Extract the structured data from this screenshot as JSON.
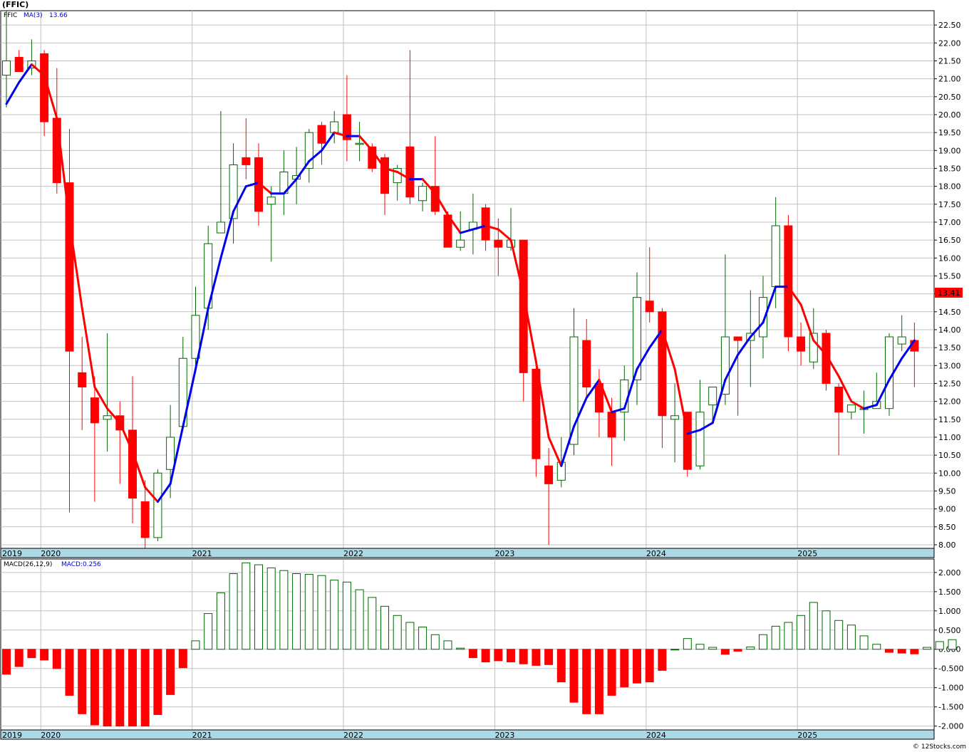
{
  "header": {
    "symbol": "(FFIC)",
    "legend_symbol": "FFIC",
    "legend_ma": "MA(3)",
    "legend_ma_value": "13.66",
    "last_price": "13.41"
  },
  "macd_panel": {
    "label": "MACD(26,12,9)",
    "value_label": "MACD:0.256"
  },
  "watermark": "© 12Stocks.com",
  "colors": {
    "up": "#006600",
    "down": "#ff0000",
    "ma_up": "#0000ee",
    "ma_down": "#ff0000",
    "grid": "#c0c0c0",
    "date_band": "#add8e6",
    "price_tag": "#ff0000"
  },
  "chart_data": [
    {
      "type": "candlestick",
      "title": "(FFIC)",
      "ylim": [
        7.9,
        22.9
      ],
      "yticks": [
        "8.00",
        "8.50",
        "9.00",
        "9.50",
        "10.00",
        "10.50",
        "11.00",
        "11.50",
        "12.00",
        "12.50",
        "13.00",
        "13.50",
        "14.00",
        "14.50",
        "15.00",
        "15.50",
        "16.00",
        "16.50",
        "17.00",
        "17.50",
        "18.00",
        "18.50",
        "19.00",
        "19.50",
        "20.00",
        "20.50",
        "21.00",
        "21.50",
        "22.00",
        "22.50"
      ],
      "year_labels": [
        "2019",
        "2020",
        "2021",
        "2022",
        "2023",
        "2024",
        "2025"
      ],
      "year_start_month_index": [
        0,
        3,
        15,
        27,
        39,
        51,
        63
      ],
      "candles": [
        {
          "o": 21.1,
          "h": 22.9,
          "l": 20.2,
          "c": 21.5
        },
        {
          "o": 21.6,
          "h": 21.8,
          "l": 21.2,
          "c": 21.2
        },
        {
          "o": 21.3,
          "h": 22.1,
          "l": 21.1,
          "c": 21.5
        },
        {
          "o": 21.7,
          "h": 21.8,
          "l": 19.4,
          "c": 19.8
        },
        {
          "o": 19.9,
          "h": 21.3,
          "l": 17.8,
          "c": 18.1
        },
        {
          "o": 18.1,
          "h": 19.6,
          "l": 8.9,
          "c": 13.4
        },
        {
          "o": 12.8,
          "h": 13.8,
          "l": 11.2,
          "c": 12.4
        },
        {
          "o": 12.1,
          "h": 12.7,
          "l": 9.2,
          "c": 11.4
        },
        {
          "o": 11.5,
          "h": 13.9,
          "l": 10.6,
          "c": 11.6
        },
        {
          "o": 11.6,
          "h": 12.0,
          "l": 9.7,
          "c": 11.2
        },
        {
          "o": 11.2,
          "h": 12.7,
          "l": 8.6,
          "c": 9.3
        },
        {
          "o": 9.2,
          "h": 9.8,
          "l": 7.9,
          "c": 8.2
        },
        {
          "o": 8.2,
          "h": 10.1,
          "l": 8.1,
          "c": 10.0
        },
        {
          "o": 10.1,
          "h": 11.9,
          "l": 9.3,
          "c": 11.0
        },
        {
          "o": 11.3,
          "h": 13.8,
          "l": 11.2,
          "c": 13.2
        },
        {
          "o": 13.2,
          "h": 15.2,
          "l": 12.9,
          "c": 14.4
        },
        {
          "o": 14.6,
          "h": 16.9,
          "l": 14.0,
          "c": 16.4
        },
        {
          "o": 16.7,
          "h": 20.1,
          "l": 16.7,
          "c": 17.0
        },
        {
          "o": 17.1,
          "h": 19.2,
          "l": 16.4,
          "c": 18.6
        },
        {
          "o": 18.8,
          "h": 19.9,
          "l": 18.2,
          "c": 18.6
        },
        {
          "o": 18.8,
          "h": 19.2,
          "l": 16.9,
          "c": 17.3
        },
        {
          "o": 17.5,
          "h": 18.0,
          "l": 15.9,
          "c": 17.7
        },
        {
          "o": 17.8,
          "h": 19.0,
          "l": 17.2,
          "c": 18.4
        },
        {
          "o": 18.2,
          "h": 19.1,
          "l": 17.5,
          "c": 18.3
        },
        {
          "o": 18.5,
          "h": 19.6,
          "l": 18.1,
          "c": 19.5
        },
        {
          "o": 19.7,
          "h": 19.8,
          "l": 18.6,
          "c": 19.2
        },
        {
          "o": 19.5,
          "h": 20.1,
          "l": 19.2,
          "c": 19.8
        },
        {
          "o": 20.0,
          "h": 21.1,
          "l": 18.7,
          "c": 19.3
        },
        {
          "o": 19.2,
          "h": 19.8,
          "l": 18.7,
          "c": 19.2
        },
        {
          "o": 19.1,
          "h": 19.2,
          "l": 18.4,
          "c": 18.5
        },
        {
          "o": 18.8,
          "h": 18.9,
          "l": 17.2,
          "c": 17.8
        },
        {
          "o": 18.1,
          "h": 18.6,
          "l": 17.6,
          "c": 18.5
        },
        {
          "o": 19.1,
          "h": 21.8,
          "l": 17.5,
          "c": 17.7
        },
        {
          "o": 17.6,
          "h": 18.1,
          "l": 17.3,
          "c": 18.0
        },
        {
          "o": 18.0,
          "h": 19.4,
          "l": 17.2,
          "c": 17.3
        },
        {
          "o": 17.2,
          "h": 17.3,
          "l": 16.3,
          "c": 16.3
        },
        {
          "o": 16.3,
          "h": 17.3,
          "l": 16.2,
          "c": 16.5
        },
        {
          "o": 16.8,
          "h": 17.8,
          "l": 16.1,
          "c": 17.0
        },
        {
          "o": 17.4,
          "h": 17.5,
          "l": 16.2,
          "c": 16.5
        },
        {
          "o": 16.5,
          "h": 17.1,
          "l": 15.5,
          "c": 16.3
        },
        {
          "o": 16.3,
          "h": 17.4,
          "l": 16.2,
          "c": 16.5
        },
        {
          "o": 16.5,
          "h": 16.5,
          "l": 12.0,
          "c": 12.8
        },
        {
          "o": 12.9,
          "h": 13.1,
          "l": 9.9,
          "c": 10.4
        },
        {
          "o": 10.2,
          "h": 10.7,
          "l": 8.0,
          "c": 9.7
        },
        {
          "o": 9.8,
          "h": 11.0,
          "l": 9.6,
          "c": 10.3
        },
        {
          "o": 10.8,
          "h": 14.6,
          "l": 10.5,
          "c": 13.8
        },
        {
          "o": 13.7,
          "h": 14.3,
          "l": 12.1,
          "c": 12.4
        },
        {
          "o": 12.5,
          "h": 12.9,
          "l": 11.0,
          "c": 11.7
        },
        {
          "o": 11.7,
          "h": 12.1,
          "l": 10.2,
          "c": 11.0
        },
        {
          "o": 11.7,
          "h": 13.0,
          "l": 10.9,
          "c": 12.6
        },
        {
          "o": 12.6,
          "h": 15.6,
          "l": 11.9,
          "c": 14.9
        },
        {
          "o": 14.8,
          "h": 16.3,
          "l": 14.2,
          "c": 14.5
        },
        {
          "o": 14.5,
          "h": 14.6,
          "l": 10.7,
          "c": 11.6
        },
        {
          "o": 11.5,
          "h": 12.5,
          "l": 10.3,
          "c": 11.6
        },
        {
          "o": 11.7,
          "h": 11.7,
          "l": 9.9,
          "c": 10.1
        },
        {
          "o": 10.2,
          "h": 12.6,
          "l": 10.1,
          "c": 11.7
        },
        {
          "o": 11.9,
          "h": 12.4,
          "l": 11.4,
          "c": 12.4
        },
        {
          "o": 12.2,
          "h": 16.1,
          "l": 11.9,
          "c": 13.8
        },
        {
          "o": 13.8,
          "h": 13.8,
          "l": 11.6,
          "c": 13.7
        },
        {
          "o": 13.7,
          "h": 15.1,
          "l": 12.4,
          "c": 13.9
        },
        {
          "o": 13.8,
          "h": 15.5,
          "l": 13.2,
          "c": 14.9
        },
        {
          "o": 15.2,
          "h": 17.7,
          "l": 14.6,
          "c": 16.9
        },
        {
          "o": 16.9,
          "h": 17.2,
          "l": 13.4,
          "c": 13.8
        },
        {
          "o": 13.8,
          "h": 14.2,
          "l": 13.0,
          "c": 13.4
        },
        {
          "o": 13.1,
          "h": 14.6,
          "l": 12.9,
          "c": 13.9
        },
        {
          "o": 13.9,
          "h": 14.0,
          "l": 12.3,
          "c": 12.5
        },
        {
          "o": 12.4,
          "h": 12.5,
          "l": 10.5,
          "c": 11.7
        },
        {
          "o": 11.7,
          "h": 11.9,
          "l": 11.5,
          "c": 11.9
        },
        {
          "o": 11.8,
          "h": 12.3,
          "l": 11.1,
          "c": 11.8
        },
        {
          "o": 11.8,
          "h": 12.8,
          "l": 11.8,
          "c": 12.0
        },
        {
          "o": 11.8,
          "h": 13.9,
          "l": 11.6,
          "c": 13.8
        },
        {
          "o": 13.6,
          "h": 14.4,
          "l": 13.4,
          "c": 13.8
        },
        {
          "o": 13.7,
          "h": 14.2,
          "l": 12.4,
          "c": 13.4
        }
      ],
      "ma3": [
        20.3,
        20.9,
        21.4,
        21.1,
        19.9,
        17.0,
        14.6,
        12.4,
        11.8,
        11.4,
        10.6,
        9.6,
        9.2,
        9.7,
        11.3,
        12.9,
        14.6,
        16.0,
        17.3,
        18.0,
        18.1,
        17.8,
        17.8,
        18.2,
        18.7,
        19.0,
        19.5,
        19.4,
        19.4,
        19.0,
        18.5,
        18.4,
        18.2,
        18.2,
        17.8,
        17.2,
        16.7,
        16.8,
        16.9,
        16.8,
        16.5,
        15.0,
        13.1,
        11.0,
        10.2,
        11.3,
        12.1,
        12.6,
        11.7,
        11.8,
        12.9,
        13.5,
        14.0,
        12.9,
        11.1,
        11.2,
        11.4,
        12.6,
        13.3,
        13.8,
        14.2,
        15.2,
        15.2,
        14.7,
        13.7,
        13.3,
        12.7,
        12.0,
        11.8,
        11.9,
        12.6,
        13.2,
        13.7
      ]
    },
    {
      "type": "bar",
      "title": "MACD(26,12,9)",
      "ylim": [
        -2.1,
        2.35
      ],
      "yticks": [
        "-2.000",
        "-1.500",
        "-1.000",
        "-0.500",
        "0.000",
        "0.500",
        "1.000",
        "1.500",
        "2.000"
      ],
      "values": [
        -0.65,
        -0.45,
        -0.22,
        -0.28,
        -0.5,
        -1.2,
        -1.68,
        -1.97,
        -2.0,
        -2.0,
        -2.0,
        -2.0,
        -1.7,
        -1.18,
        -0.48,
        0.22,
        0.93,
        1.47,
        1.97,
        2.25,
        2.2,
        2.12,
        2.05,
        1.97,
        1.95,
        1.92,
        1.8,
        1.75,
        1.55,
        1.35,
        1.12,
        0.88,
        0.7,
        0.58,
        0.38,
        0.22,
        0.03,
        -0.22,
        -0.33,
        -0.3,
        -0.33,
        -0.38,
        -0.42,
        -0.4,
        -0.85,
        -1.38,
        -1.68,
        -1.68,
        -1.2,
        -0.98,
        -0.88,
        -0.85,
        -0.55,
        0.0,
        0.28,
        0.13,
        0.05,
        -0.13,
        -0.05,
        0.06,
        0.38,
        0.6,
        0.7,
        0.88,
        1.22,
        1.0,
        0.75,
        0.63,
        0.35,
        0.13,
        -0.08,
        -0.1,
        -0.12,
        0.05,
        0.2,
        0.25
      ]
    }
  ]
}
